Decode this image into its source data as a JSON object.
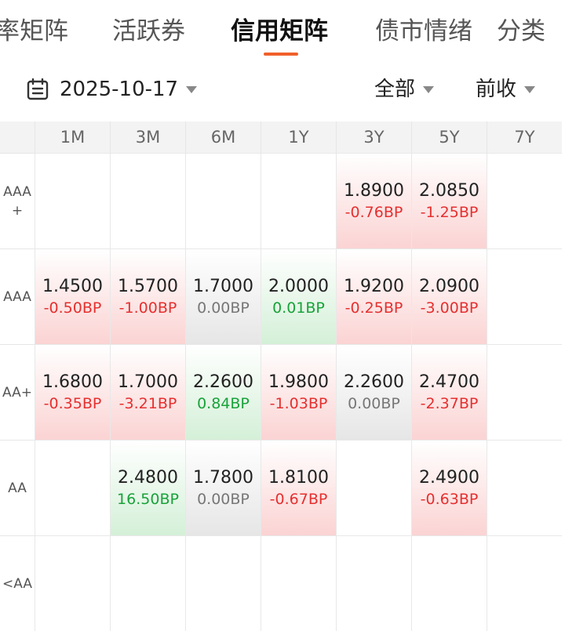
{
  "tabs": [
    {
      "label": "率矩阵",
      "active": false
    },
    {
      "label": "活跃券",
      "active": false
    },
    {
      "label": "信用矩阵",
      "active": true
    },
    {
      "label": "债市情绪",
      "active": false
    },
    {
      "label": "分类",
      "active": false
    }
  ],
  "filters": {
    "date": "2025-10-17",
    "scope": "全部",
    "compare": "前收"
  },
  "colors": {
    "accent": "#f0602a",
    "up": "#e5302f",
    "down": "#19a23a",
    "flat": "#777777"
  },
  "matrix": {
    "columns": [
      "1M",
      "3M",
      "6M",
      "1Y",
      "3Y",
      "5Y",
      "7Y"
    ],
    "rows": [
      {
        "rating": "AAA\n+",
        "cells": [
          null,
          null,
          null,
          null,
          {
            "value": "1.8900",
            "change": "-0.76BP",
            "trend": "up"
          },
          {
            "value": "2.0850",
            "change": "-1.25BP",
            "trend": "up"
          },
          null
        ]
      },
      {
        "rating": "AAA",
        "cells": [
          {
            "value": "1.4500",
            "change": "-0.50BP",
            "trend": "up"
          },
          {
            "value": "1.5700",
            "change": "-1.00BP",
            "trend": "up"
          },
          {
            "value": "1.7000",
            "change": "0.00BP",
            "trend": "flat"
          },
          {
            "value": "2.0000",
            "change": "0.01BP",
            "trend": "down"
          },
          {
            "value": "1.9200",
            "change": "-0.25BP",
            "trend": "up"
          },
          {
            "value": "2.0900",
            "change": "-3.00BP",
            "trend": "up"
          },
          null
        ]
      },
      {
        "rating": "AA+",
        "cells": [
          {
            "value": "1.6800",
            "change": "-0.35BP",
            "trend": "up"
          },
          {
            "value": "1.7000",
            "change": "-3.21BP",
            "trend": "up"
          },
          {
            "value": "2.2600",
            "change": "0.84BP",
            "trend": "down"
          },
          {
            "value": "1.9800",
            "change": "-1.03BP",
            "trend": "up"
          },
          {
            "value": "2.2600",
            "change": "0.00BP",
            "trend": "flat"
          },
          {
            "value": "2.4700",
            "change": "-2.37BP",
            "trend": "up"
          },
          null
        ]
      },
      {
        "rating": "AA",
        "cells": [
          null,
          {
            "value": "2.4800",
            "change": "16.50BP",
            "trend": "down"
          },
          {
            "value": "1.7800",
            "change": "0.00BP",
            "trend": "flat"
          },
          {
            "value": "1.8100",
            "change": "-0.67BP",
            "trend": "up"
          },
          null,
          {
            "value": "2.4900",
            "change": "-0.63BP",
            "trend": "up"
          },
          null
        ]
      },
      {
        "rating": "<AA",
        "cells": [
          null,
          null,
          null,
          null,
          null,
          null,
          null
        ]
      }
    ]
  }
}
